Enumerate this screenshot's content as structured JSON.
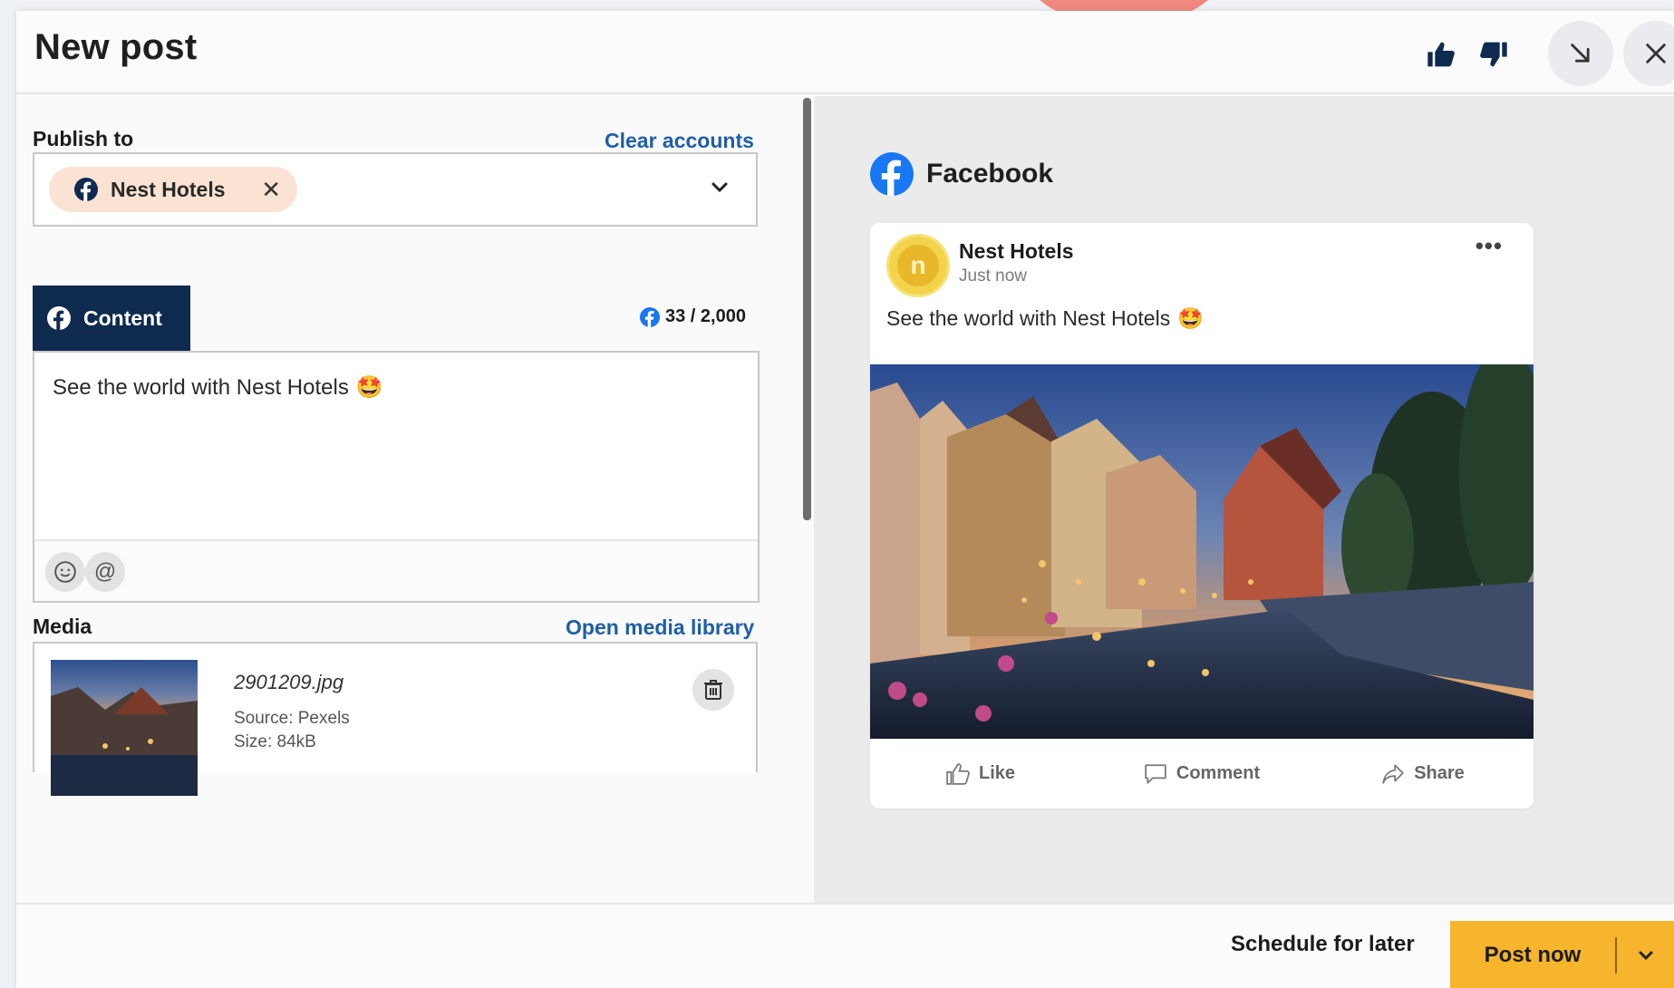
{
  "header": {
    "title": "New post",
    "icons": [
      "thumbs-up-icon",
      "thumbs-down-icon",
      "minimize-icon",
      "close-icon"
    ]
  },
  "publish": {
    "label": "Publish to",
    "clear_link": "Clear accounts",
    "selected_account": "Nest Hotels"
  },
  "content": {
    "tab_label": "Content",
    "counter": "33 / 2,000",
    "text": "See the world with Nest Hotels",
    "emoji": "🤩",
    "toolbar": [
      "emoji-icon",
      "mention-icon"
    ]
  },
  "media": {
    "label": "Media",
    "library_link": "Open media library",
    "file_name": "2901209.jpg",
    "source": "Source: Pexels",
    "size": "Size: 84kB"
  },
  "preview": {
    "platform": "Facebook",
    "account_name": "Nest Hotels",
    "time": "Just now",
    "post_text": "See the world with Nest Hotels",
    "more": "•••",
    "actions": {
      "like": "Like",
      "comment": "Comment",
      "share": "Share"
    }
  },
  "footer": {
    "schedule": "Schedule for later",
    "post_now": "Post now"
  },
  "colors": {
    "facebook_blue": "#1877f2",
    "tab_navy": "#0f2a4f",
    "link_blue": "#1f5ea8",
    "post_button": "#f6b52c",
    "chip_bg": "#fbe3d4",
    "accent_red": "#f0776a"
  }
}
